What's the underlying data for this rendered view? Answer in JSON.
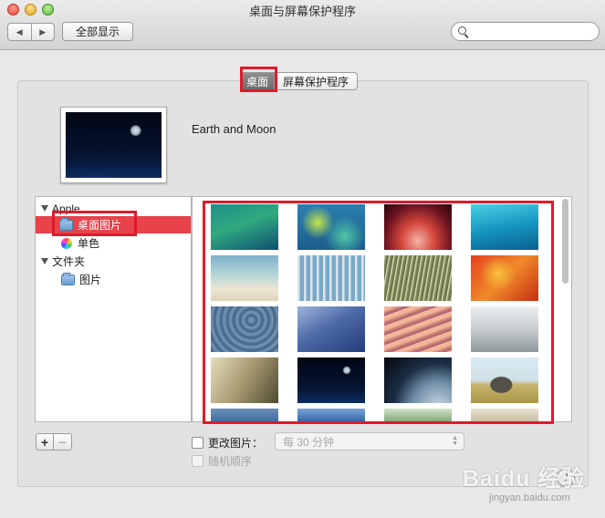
{
  "window": {
    "title": "桌面与屏幕保护程序"
  },
  "toolbar": {
    "back_glyph": "◀",
    "forward_glyph": "▶",
    "show_all_label": "全部显示",
    "search_placeholder": ""
  },
  "tabs": [
    {
      "label": "桌面",
      "active": true
    },
    {
      "label": "屏幕保护程序",
      "active": false
    }
  ],
  "current_wallpaper": {
    "name": "Earth and Moon"
  },
  "sources": {
    "apple_group": "Apple",
    "desktop_pictures": "桌面图片",
    "solid_colors": "单色",
    "folders_group": "文件夹",
    "pictures": "图片"
  },
  "thumbnails": [
    {
      "name": "wave-green"
    },
    {
      "name": "ocean-aerial"
    },
    {
      "name": "antelope-canyon"
    },
    {
      "name": "turquoise-water"
    },
    {
      "name": "beach-sand"
    },
    {
      "name": "frozen-trees"
    },
    {
      "name": "grass-field"
    },
    {
      "name": "autumn-leaves"
    },
    {
      "name": "blue-ripples"
    },
    {
      "name": "glacier-ice"
    },
    {
      "name": "sand-dunes"
    },
    {
      "name": "misty-lake"
    },
    {
      "name": "foggy-forest"
    },
    {
      "name": "earth-and-moon"
    },
    {
      "name": "earth-orbit"
    },
    {
      "name": "elephant-savanna"
    }
  ],
  "bottom": {
    "add_glyph": "+",
    "remove_glyph": "−",
    "change_picture_label": "更改图片：",
    "interval_value": "每 30 分钟",
    "random_order_label": "随机顺序",
    "help_glyph": "?"
  },
  "watermark": {
    "logo": "Baidu 经验",
    "url": "jingyan.baidu.com"
  },
  "colors": {
    "highlight": "#e01a2a",
    "selection": "#e8424b"
  }
}
